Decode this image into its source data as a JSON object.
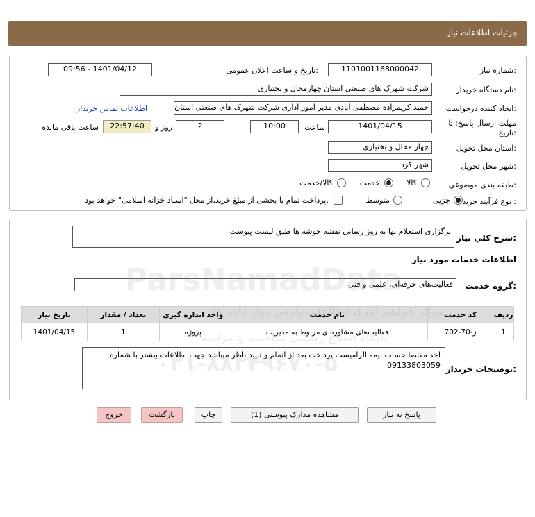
{
  "header": {
    "title": "جزئیات اطلاعات نیاز"
  },
  "info": {
    "need_number_label": "شماره نیاز:",
    "need_number": "1101001168000042",
    "announce_label": "تاریخ و ساعت اعلان عمومی:",
    "announce_value": "1401/04/12 - 09:56",
    "buyer_org_label": "نام دستگاه خریدار:",
    "buyer_org": "شرکت شهرک های صنعتی استان چهارمحال و بختیاری",
    "creator_label": "ایجاد کننده درخواست:",
    "creator": "حمید کریمزاده مصطفی آبادی مدیر امور اداری شرکت شهرک های صنعتی استان",
    "contact_link": "اطلاعات تماس خریدار",
    "deadline_label_1": "مهلت ارسال پاسخ: تا",
    "deadline_label_2": "تاریخ:",
    "deadline_date": "1401/04/15",
    "time_label": "ساعت",
    "deadline_time": "10:00",
    "days": "2",
    "days_label": "روز و",
    "remaining_time": "22:57:40",
    "remaining_label": "ساعت باقی مانده",
    "province_label": "استان محل تحویل:",
    "province": "چهار محال و بختیاری",
    "city_label": "شهر محل تحویل:",
    "city": "شهر کرد",
    "category_label": "طبقه بندی موضوعی:",
    "category_options": [
      "کالا",
      "خدمت",
      "کالا/خدمت"
    ],
    "category_selected": 1,
    "process_label": "نوع فرآیند خرید :",
    "process_options": [
      "جزیی",
      "متوسط"
    ],
    "process_selected": 0,
    "treasury_text": "پرداخت تمام یا بخشی از مبلغ خرید،از محل \"اسناد خزانه اسلامی\" خواهد بود."
  },
  "summary": {
    "label": "شرح کلي نياز:",
    "value": "برگزاری استعلام بها به روز رسانی نقشه خوشه ها طبق لیست پیوست",
    "services_header": "اطلاعات خدمات مورد نیاز",
    "service_group_label": "گروه خدمت:",
    "service_group": "فعالیت‌های حرفه‌ای، علمی و فنی"
  },
  "table": {
    "headers": [
      "ردیف",
      "کد خدمت",
      "نام خدمت",
      "واحد اندازه گیری",
      "تعداد / مقدار",
      "تاریخ نیاز"
    ],
    "rows": [
      [
        "1",
        "ز-70-702",
        "فعالیت‌های مشاوره‌ای مربوط به مدیریت",
        "پروژه",
        "1",
        "1401/04/15"
      ]
    ]
  },
  "buyer_notes": {
    "label": "توضیحات خریدار:",
    "value": "اخذ مفاصا حساب بیمه الزامیست پرداخت بعد از اتمام و تایید ناظر میباشد جهت اطلاعات بیشتر با شماره 09133803059"
  },
  "buttons": {
    "reply": "پاسخ به نیاز",
    "attachments": "مشاهده مدارک پیوستی (1)",
    "print": "چاپ",
    "back": "بازگشت",
    "exit": "خروج"
  },
  "watermark": {
    "brand": "ParsNamadData",
    "tagline_1": "مرکز فراهم آوری اطلاعات پارس نماد داده ها",
    "tagline_2": "پایگاه اطلاع رسانی مناقصه و مزایده",
    "phone": "۰۲۱-۸۸۳۴۹۶۷۰-۵"
  },
  "colors": {
    "title_bar": "#8b6a4a",
    "link": "#1a3fb0",
    "timer_bg": "#f0ecc4",
    "button_pink": "#f5c5c5"
  }
}
